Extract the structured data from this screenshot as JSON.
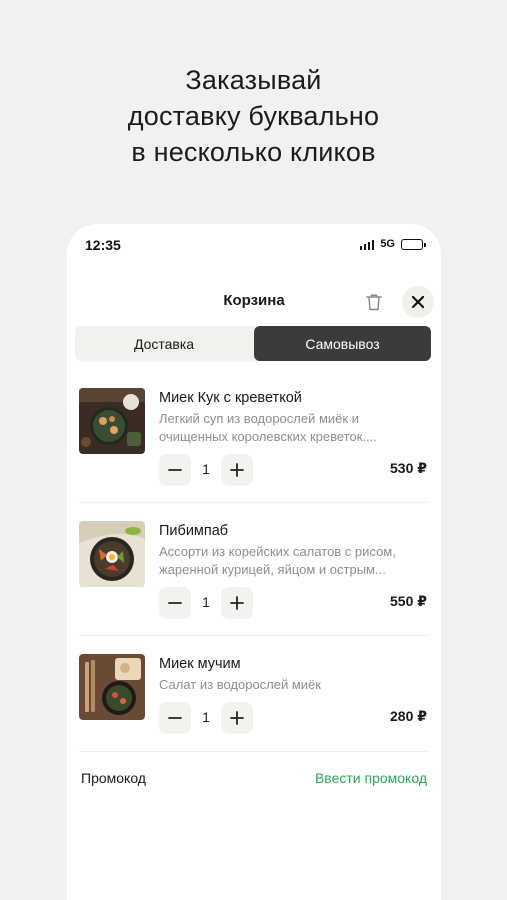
{
  "headline": [
    "Заказывай",
    "доставку буквально",
    "в несколько кликов"
  ],
  "status_bar": {
    "time": "12:35",
    "network": "5G"
  },
  "header": {
    "title": "Корзина"
  },
  "tabs": {
    "delivery": "Доставка",
    "pickup": "Самовывоз",
    "selected": "pickup"
  },
  "items": [
    {
      "name": "Миек Кук с креветкой",
      "desc_lines": [
        "Легкий суп из водорослей миёк и",
        "очищенных королевских креветок...."
      ],
      "qty": "1",
      "price": "530 ₽"
    },
    {
      "name": "Пибимпаб",
      "desc_lines": [
        "Ассорти из корейских салатов с рисом,",
        "жаренной курицей, яйцом и острым..."
      ],
      "qty": "1",
      "price": "550 ₽"
    },
    {
      "name": "Миек мучим",
      "desc_lines": [
        "Салат из водорослей миёк"
      ],
      "qty": "1",
      "price": "280 ₽"
    }
  ],
  "promo": {
    "label": "Промокод",
    "action": "Ввести промокод"
  },
  "colors": {
    "accent_green": "#2fa55a",
    "segment_active": "#3b3b39",
    "background": "#f1f1f1"
  },
  "icons": [
    "signal-icon",
    "battery-icon",
    "trash-icon",
    "close-icon",
    "minus-icon",
    "plus-icon"
  ]
}
